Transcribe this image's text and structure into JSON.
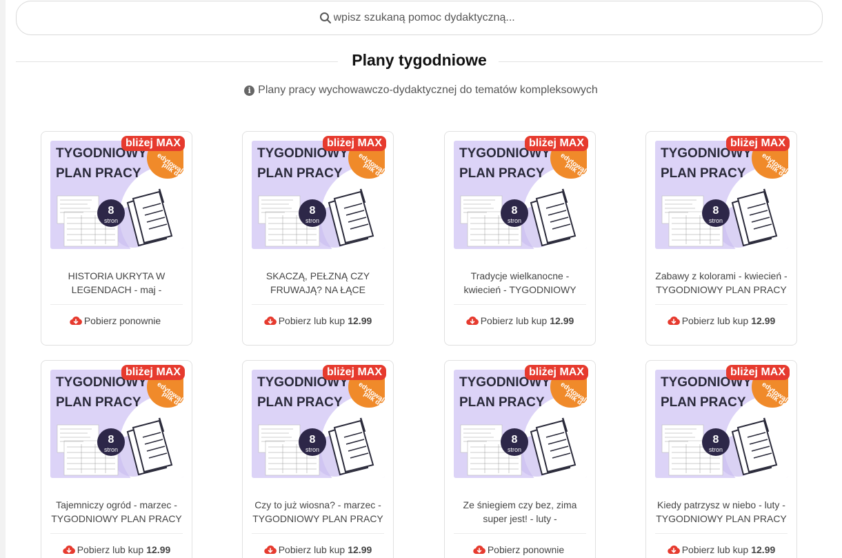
{
  "search": {
    "placeholder": "wpisz szukaną pomoc dydaktyczną..."
  },
  "section": {
    "title": "Plany tygodniowe",
    "subtitle": "Plany pracy wychowawczo-dydaktycznej do tematów kompleksowych"
  },
  "thumbnail": {
    "line1": "TYGODNIOWY",
    "line2": "PLAN PRACY",
    "pages_number": "8",
    "pages_label": "stron",
    "sticker_line1": "edytowalny",
    "sticker_line2": "plik doc"
  },
  "colors": {
    "badge": "#e63a2e",
    "thumb_bg": "#dcd3f7",
    "sticker": "#f08a2a",
    "circle": "#2d2748",
    "download_icon": "#e63a2e"
  },
  "cards": [
    {
      "badge": "bliżej MAX",
      "title": "HISTORIA UKRYTA W LEGENDACH - maj -",
      "action": "Pobierz ponownie",
      "price": ""
    },
    {
      "badge": "bliżej MAX",
      "title": "SKACZĄ, PEŁZNĄ CZY FRUWAJĄ? NA ŁĄCE",
      "action": "Pobierz lub kup",
      "price": "12.99"
    },
    {
      "badge": "bliżej MAX",
      "title": "Tradycje wielkanocne - kwiecień - TYGODNIOWY",
      "action": "Pobierz lub kup",
      "price": "12.99"
    },
    {
      "badge": "bliżej MAX",
      "title": "Zabawy z kolorami - kwiecień - TYGODNIOWY PLAN PRACY",
      "action": "Pobierz lub kup",
      "price": "12.99"
    },
    {
      "badge": "bliżej MAX",
      "title": "Tajemniczy ogród - marzec - TYGODNIOWY PLAN PRACY",
      "action": "Pobierz lub kup",
      "price": "12.99"
    },
    {
      "badge": "bliżej MAX",
      "title": "Czy to już wiosna? - marzec - TYGODNIOWY PLAN PRACY",
      "action": "Pobierz lub kup",
      "price": "12.99"
    },
    {
      "badge": "bliżej MAX",
      "title": "Ze śniegiem czy bez, zima super jest! - luty -",
      "action": "Pobierz ponownie",
      "price": ""
    },
    {
      "badge": "bliżej MAX",
      "title": "Kiedy patrzysz w niebo - luty - TYGODNIOWY PLAN PRACY",
      "action": "Pobierz lub kup",
      "price": "12.99"
    }
  ]
}
